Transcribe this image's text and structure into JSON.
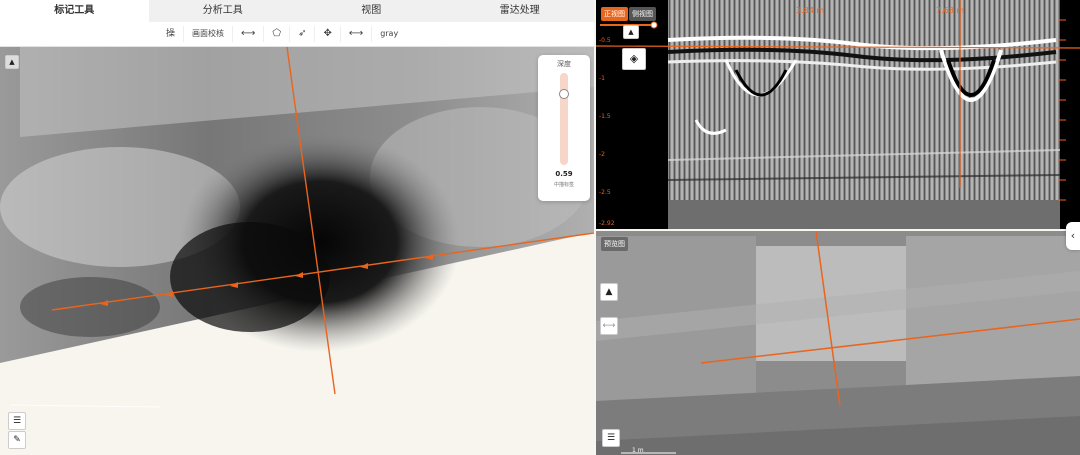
{
  "tabs": [
    "标记工具",
    "分析工具",
    "视图",
    "雷达处理"
  ],
  "toolbar": {
    "label_1": "操",
    "label_2": "画面校核",
    "colormap": "gray"
  },
  "depth_panel": {
    "title": "深度",
    "value": "0.59",
    "caption": "中描标签",
    "level_fraction": 0.15
  },
  "radar": {
    "btn_front": "正视图",
    "btn_side": "侧视图",
    "top_marks": [
      "3.84 m",
      "7.68 m"
    ],
    "depth_ticks": [
      "-0.5",
      "-1",
      "-1.5",
      "-2",
      "-2.5",
      "-2.92"
    ],
    "accent": "#e8651e"
  },
  "preview": {
    "label": "预览图",
    "scale": "1 m"
  },
  "icons": {
    "collapse": "chevron-left-icon"
  }
}
